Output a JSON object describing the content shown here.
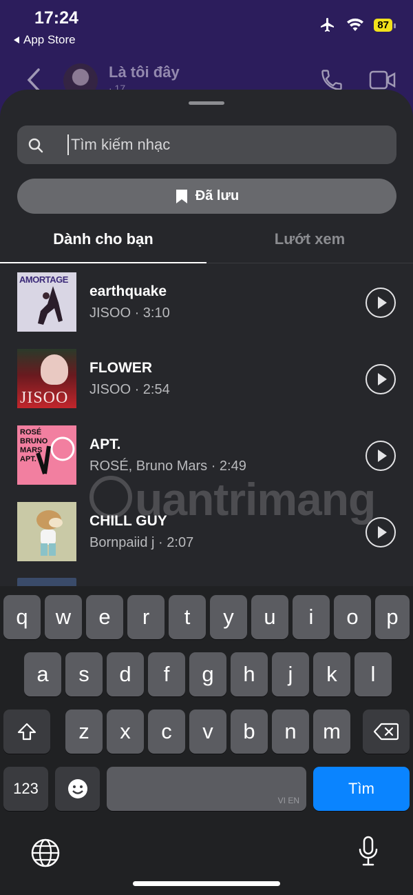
{
  "status_bar": {
    "time": "17:24",
    "back_app": "App Store",
    "battery": "87"
  },
  "chat_header": {
    "name": "Là tôi đây",
    "subtitle": "· 17"
  },
  "sheet": {
    "search": {
      "placeholder": "Tìm kiếm nhạc",
      "icon": "search-icon"
    },
    "saved_button": {
      "label": "Đã lưu",
      "icon": "bookmark-icon"
    },
    "tabs": [
      {
        "label": "Dành cho bạn",
        "active": true
      },
      {
        "label": "Lướt xem",
        "active": false
      }
    ],
    "tracks": [
      {
        "title": "earthquake",
        "subtitle": "JISOO · 3:10",
        "cover_text": "AMORTAGE"
      },
      {
        "title": "FLOWER",
        "subtitle": "JISOO · 2:54",
        "cover_text": "JISOO"
      },
      {
        "title": "APT.",
        "subtitle": "ROSÉ, Bruno Mars · 2:49",
        "cover_text": "ROSÉ BRUNO MARS APT."
      },
      {
        "title": "CHILL GUY",
        "subtitle": "Bornpaiid j · 2:07",
        "cover_text": ""
      }
    ],
    "watermark": "uantrimang"
  },
  "keyboard": {
    "row1": [
      "q",
      "w",
      "e",
      "r",
      "t",
      "y",
      "u",
      "i",
      "o",
      "p"
    ],
    "row2": [
      "a",
      "s",
      "d",
      "f",
      "g",
      "h",
      "j",
      "k",
      "l"
    ],
    "row3": [
      "z",
      "x",
      "c",
      "v",
      "b",
      "n",
      "m"
    ],
    "numbers_label": "123",
    "space_hint": "VI EN",
    "action_label": "Tìm"
  },
  "colors": {
    "accent": "#0a84ff",
    "sheet_bg": "#26272b",
    "header_bg": "#2c1d5c",
    "battery": "#f2e21b"
  }
}
